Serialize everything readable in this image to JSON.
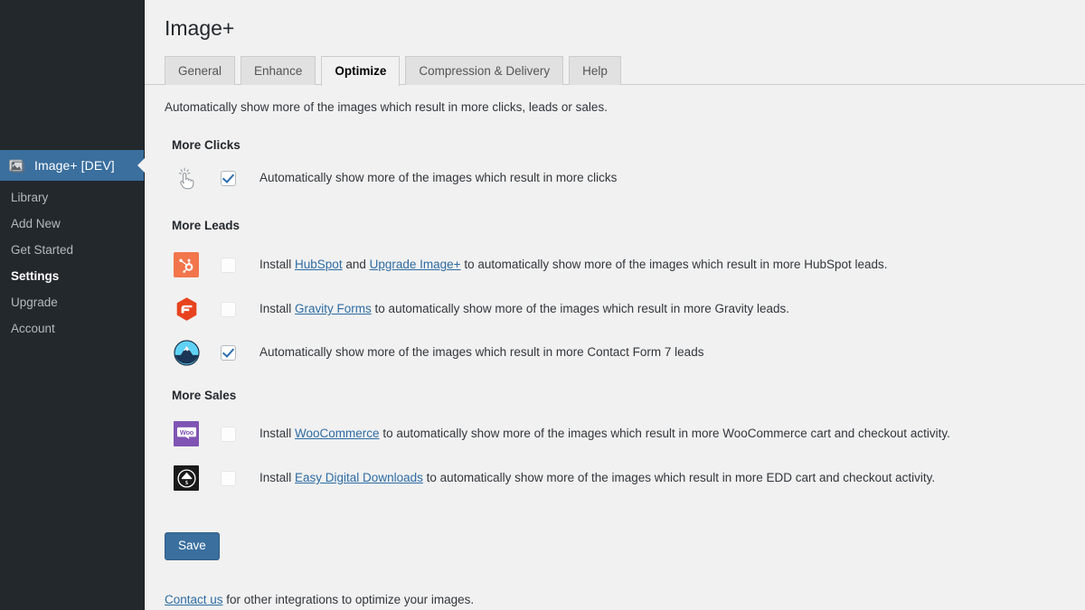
{
  "sidebar": {
    "current_item": {
      "label": "Image+ [DEV]",
      "icon": "image-icon"
    },
    "items": [
      {
        "label": "Library",
        "active": false
      },
      {
        "label": "Add New",
        "active": false
      },
      {
        "label": "Get Started",
        "active": false
      },
      {
        "label": "Settings",
        "active": true
      },
      {
        "label": "Upgrade",
        "active": false
      },
      {
        "label": "Account",
        "active": false
      }
    ]
  },
  "header": {
    "title": "Image+"
  },
  "tabs": [
    {
      "label": "General",
      "active": false
    },
    {
      "label": "Enhance",
      "active": false
    },
    {
      "label": "Optimize",
      "active": true
    },
    {
      "label": "Compression & Delivery",
      "active": false
    },
    {
      "label": "Help",
      "active": false
    }
  ],
  "main": {
    "intro": "Automatically show more of the images which result in more clicks, leads or sales.",
    "groups": {
      "clicks": {
        "title": "More Clicks",
        "row": {
          "icon": "click-hand-icon",
          "checked": true,
          "text": "Automatically show more of the images which result in more clicks"
        }
      },
      "leads": {
        "title": "More Leads",
        "rows": [
          {
            "icon": "hubspot-icon",
            "checked": false,
            "prefix": "Install ",
            "link1": "HubSpot",
            "middle": " and ",
            "link2": "Upgrade Image+",
            "suffix": " to automatically show more of the images which result in more HubSpot leads."
          },
          {
            "icon": "gravity-forms-icon",
            "checked": false,
            "prefix": "Install ",
            "link1": "Gravity Forms",
            "suffix": " to automatically show more of the images which result in more Gravity leads."
          },
          {
            "icon": "contact-form-7-icon",
            "checked": true,
            "text": "Automatically show more of the images which result in more Contact Form 7 leads"
          }
        ]
      },
      "sales": {
        "title": "More Sales",
        "rows": [
          {
            "icon": "woocommerce-icon",
            "checked": false,
            "prefix": "Install ",
            "link1": "WooCommerce",
            "suffix": " to automatically show more of the images which result in more WooCommerce cart and checkout activity."
          },
          {
            "icon": "easy-digital-downloads-icon",
            "checked": false,
            "prefix": "Install ",
            "link1": "Easy Digital Downloads",
            "suffix": " to automatically show more of the images which result in more EDD cart and checkout activity."
          }
        ]
      }
    },
    "save_label": "Save",
    "footer": {
      "link": "Contact us",
      "rest": " for other integrations to optimize your images."
    }
  },
  "colors": {
    "sidebar_bg": "#23282d",
    "sidebar_active": "#3a6f9e",
    "page_bg": "#f1f1f1",
    "link": "#2e6ca3",
    "button": "#3a6f9e",
    "hubspot": "#f2754b",
    "gravity_forms": "#e7431f",
    "contact_form_7": "#5fd2f5",
    "woocommerce": "#7f54b3",
    "edd": "#1a1a1a"
  }
}
